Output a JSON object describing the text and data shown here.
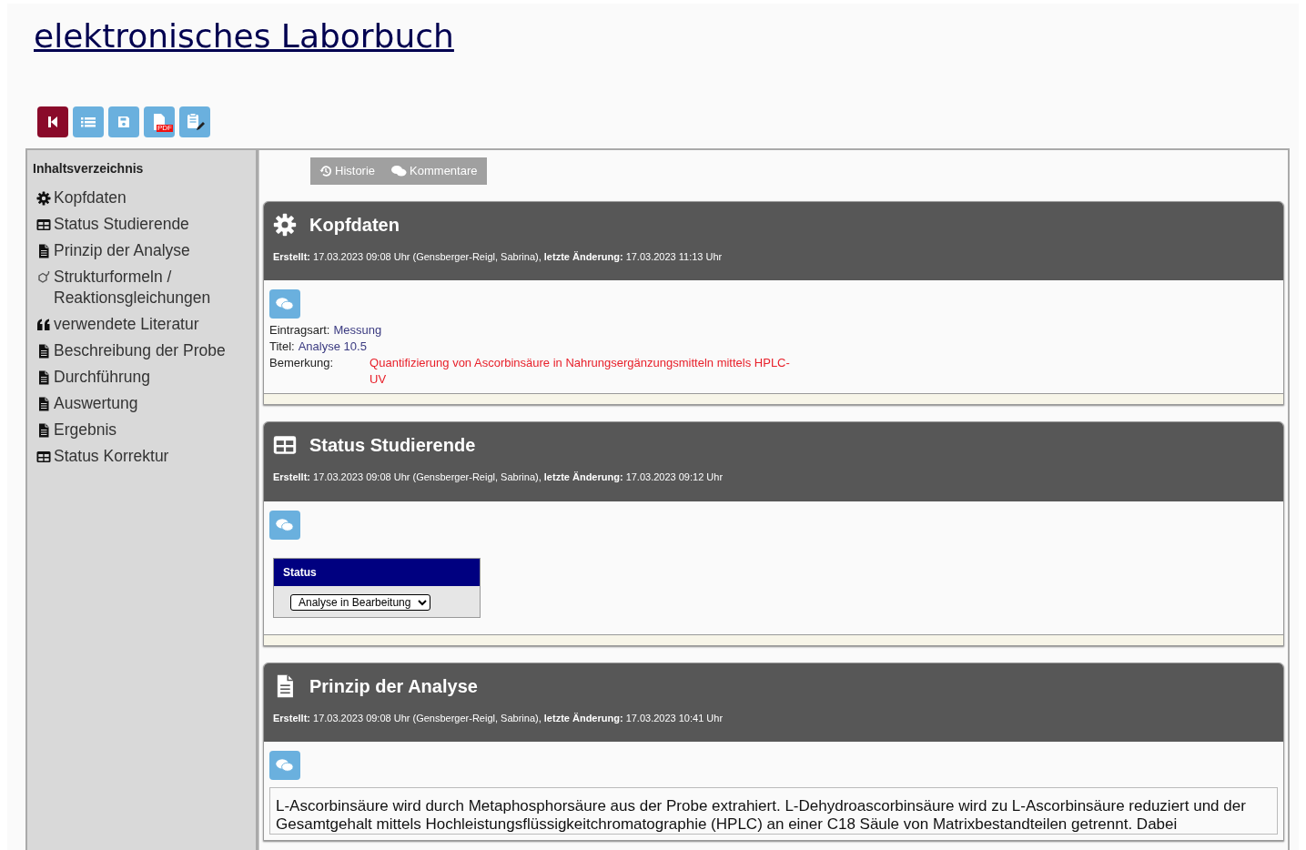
{
  "page_title": "elektronisches Laborbuch",
  "toolbar": [
    {
      "kind": "back"
    },
    {
      "kind": "list"
    },
    {
      "kind": "save"
    },
    {
      "kind": "pdf",
      "label": "PDF"
    },
    {
      "kind": "clipboard"
    }
  ],
  "sidebar": {
    "title": "Inhaltsverzeichnis",
    "items": [
      {
        "kind": "gear",
        "label": "Kopfdaten"
      },
      {
        "kind": "table",
        "label": "Status Studierende"
      },
      {
        "kind": "doc",
        "label": "Prinzip der Analyse"
      },
      {
        "kind": "structure",
        "label": "Strukturformeln / Reaktionsgleichungen"
      },
      {
        "kind": "quote",
        "label": "verwendete Literatur"
      },
      {
        "kind": "doc",
        "label": "Beschreibung der Probe"
      },
      {
        "kind": "doc",
        "label": "Durchführung"
      },
      {
        "kind": "doc",
        "label": "Auswertung"
      },
      {
        "kind": "doc",
        "label": "Ergebnis"
      },
      {
        "kind": "table",
        "label": "Status Korrektur"
      }
    ]
  },
  "tabs": [
    {
      "kind": "history",
      "label": "Historie"
    },
    {
      "kind": "comments",
      "label": "Kommentare"
    }
  ],
  "sections": [
    {
      "kind": "fields",
      "title": "Kopfdaten",
      "meta": "**Erstellt:** 17.03.2023 09:08 Uhr (Gensberger-Reigl, Sabrina), **letzte Änderung:** 17.03.2023 11:13 Uhr",
      "fields": [
        {
          "kind": "plain",
          "label": "Eintragsart:",
          "value": "Messung"
        },
        {
          "kind": "plain",
          "label": "Titel:",
          "value": "Analyse 10.5"
        },
        {
          "kind": "remark",
          "label": "Bemerkung:",
          "value": "Quantifizierung von Ascorbinsäure in Nahrungsergänzungsmitteln mittels HPLC-UV"
        }
      ]
    },
    {
      "kind": "status",
      "title": "Status Studierende",
      "meta": "**Erstellt:** 17.03.2023 09:08 Uhr (Gensberger-Reigl, Sabrina), **letzte Änderung:** 17.03.2023 09:12 Uhr",
      "status_table": {
        "heading": "Status",
        "value": "Analyse in Bearbeitung"
      }
    },
    {
      "kind": "text",
      "title": "Prinzip der Analyse",
      "meta": "**Erstellt:** 17.03.2023 09:08 Uhr (Gensberger-Reigl, Sabrina), **letzte Änderung:** 17.03.2023 10:41 Uhr",
      "text": "L-Ascorbinsäure wird durch Metaphosphorsäure aus der Probe extrahiert. L-Dehydroascorbinsäure wird zu L-Ascorbinsäure reduziert und der Gesamtgehalt mittels Hochleistungsflüssigkeitchromatographie (HPLC) an einer C18 Säule von Matrixbestandteilen getrennt. Dabei"
    }
  ]
}
